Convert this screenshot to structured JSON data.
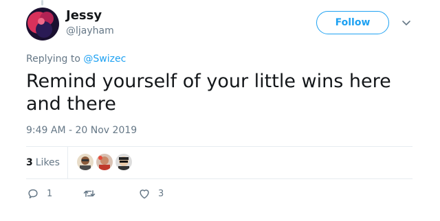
{
  "author": {
    "name": "Jessy",
    "handle": "@ljayham"
  },
  "follow_label": "Follow",
  "replying": {
    "prefix": "Replying to",
    "mention": "@Swizec"
  },
  "tweet_text": "Remind yourself of your little wins here and there",
  "timestamp": "9:49 AM - 20 Nov 2019",
  "likes": {
    "count": "3",
    "label": "Likes"
  },
  "actions": {
    "reply_count": "1",
    "retweet_count": "",
    "like_count": "3"
  },
  "colors": {
    "accent": "#1da1f2",
    "muted": "#657786",
    "text": "#14171a",
    "border": "#e6ecf0"
  },
  "icons": {
    "reply": "reply-icon",
    "retweet": "retweet-icon",
    "like": "heart-icon",
    "more": "chevron-down-icon"
  }
}
